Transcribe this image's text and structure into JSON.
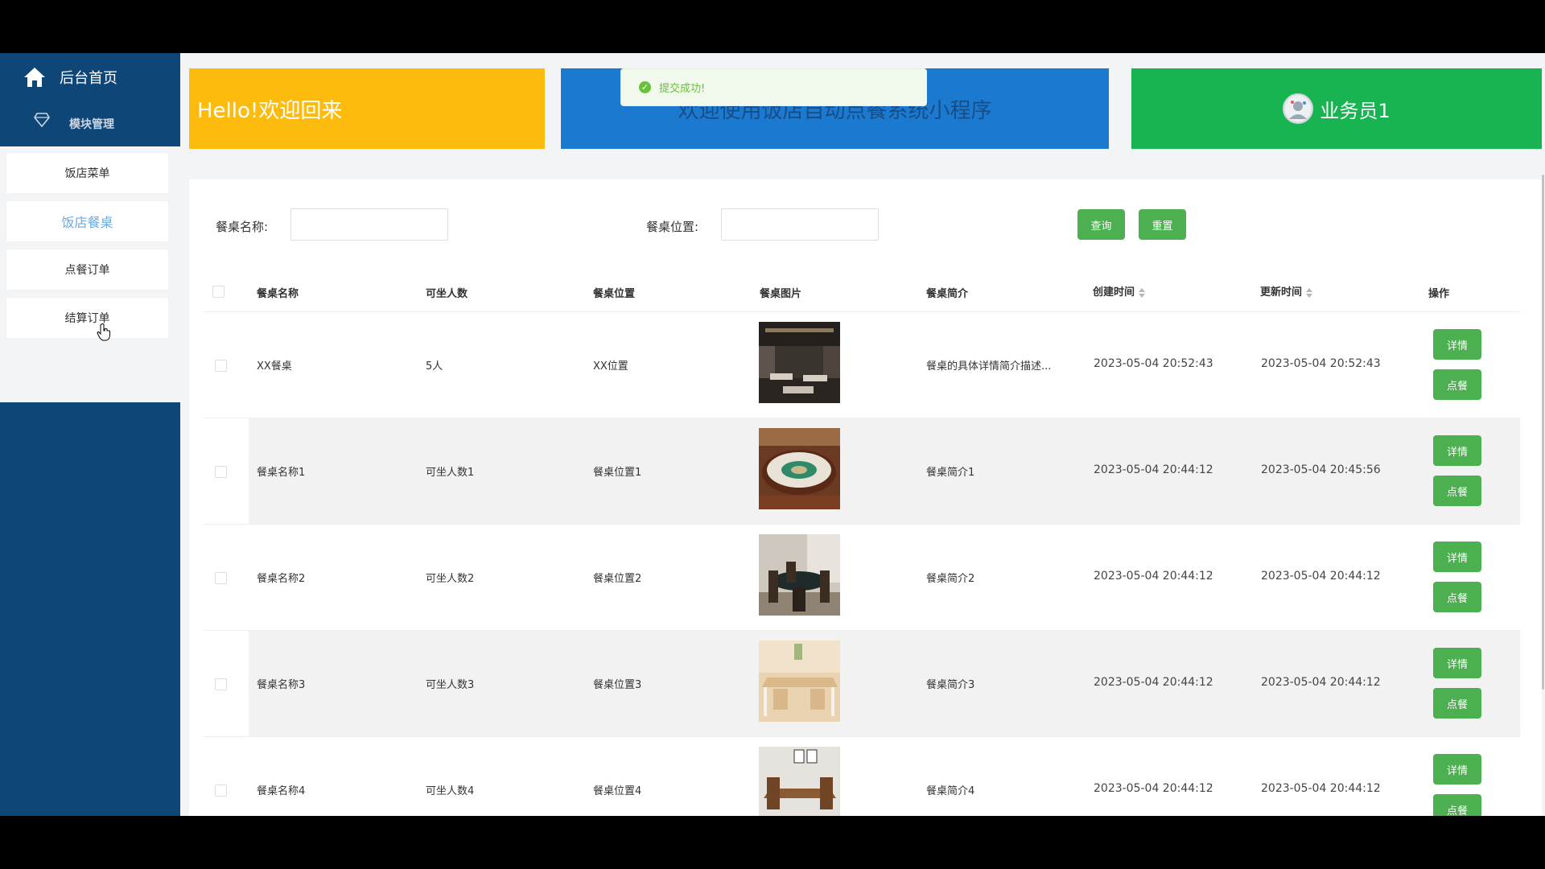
{
  "sidebar": {
    "home_label": "后台首页",
    "module_label": "模块管理",
    "items": [
      {
        "label": "饭店菜单"
      },
      {
        "label": "饭店餐桌"
      },
      {
        "label": "点餐订单"
      },
      {
        "label": "结算订单"
      }
    ],
    "active_item": "饭店餐桌"
  },
  "cards": {
    "welcome": "Hello!欢迎回来",
    "system_title": "欢迎使用饭店自动点餐系统小程序",
    "user_name": "业务员1"
  },
  "toast": {
    "message": "提交成功!"
  },
  "search": {
    "name_label": "餐桌名称:",
    "name_value": "",
    "position_label": "餐桌位置:",
    "position_value": "",
    "query_button": "查询",
    "reset_button": "重置"
  },
  "table": {
    "headers": {
      "name": "餐桌名称",
      "seats": "可坐人数",
      "position": "餐桌位置",
      "image": "餐桌图片",
      "intro": "餐桌简介",
      "created": "创建时间",
      "updated": "更新时间",
      "actions": "操作"
    },
    "detail_button": "详情",
    "order_button": "点餐",
    "rows": [
      {
        "name": "XX餐桌",
        "seats": "5人",
        "position": "XX位置",
        "image": "dark-restaurant-hall",
        "intro": "餐桌的具体详情简介描述...",
        "created": "2023-05-04 20:52:43",
        "updated": "2023-05-04 20:52:43"
      },
      {
        "name": "餐桌名称1",
        "seats": "可坐人数1",
        "position": "餐桌位置1",
        "image": "round-banquet-table",
        "intro": "餐桌简介1",
        "created": "2023-05-04 20:44:12",
        "updated": "2023-05-04 20:45:56"
      },
      {
        "name": "餐桌名称2",
        "seats": "可坐人数2",
        "position": "餐桌位置2",
        "image": "round-dining-table",
        "intro": "餐桌简介2",
        "created": "2023-05-04 20:44:12",
        "updated": "2023-05-04 20:44:12"
      },
      {
        "name": "餐桌名称3",
        "seats": "可坐人数3",
        "position": "餐桌位置3",
        "image": "white-wood-table",
        "intro": "餐桌简介3",
        "created": "2023-05-04 20:44:12",
        "updated": "2023-05-04 20:44:12"
      },
      {
        "name": "餐桌名称4",
        "seats": "可坐人数4",
        "position": "餐桌位置4",
        "image": "wooden-table-set",
        "intro": "餐桌简介4",
        "created": "2023-05-04 20:44:12",
        "updated": "2023-05-04 20:44:12"
      }
    ]
  },
  "colors": {
    "sidebar_bg": "#0d4677",
    "welcome_card": "#fdbc0d",
    "title_card": "#1b7ad0",
    "user_card": "#18b451",
    "action_button": "#4caf50",
    "active_menu_text": "#6aa9e0"
  }
}
